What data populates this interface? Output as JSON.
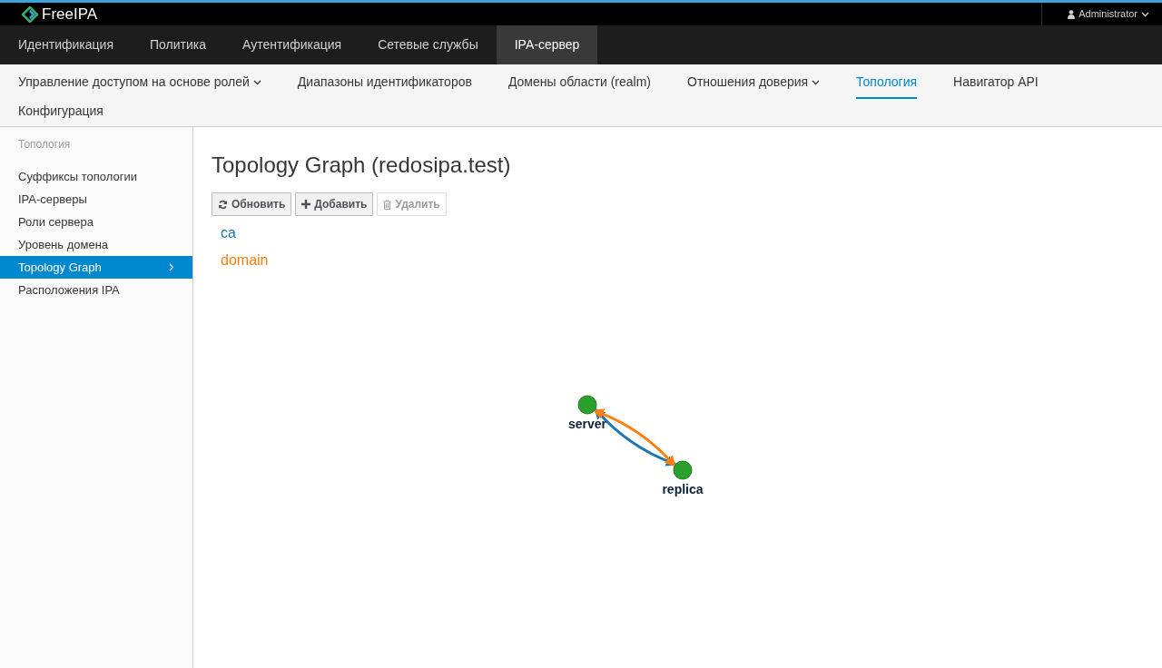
{
  "brand": "FreeIPA",
  "user": {
    "name": "Administrator"
  },
  "main_nav": [
    {
      "label": "Идентификация",
      "selected": false
    },
    {
      "label": "Политика",
      "selected": false
    },
    {
      "label": "Аутентификация",
      "selected": false
    },
    {
      "label": "Сетевые службы",
      "selected": false
    },
    {
      "label": "IPA-сервер",
      "selected": true
    }
  ],
  "sub_nav": [
    {
      "label": "Управление доступом на основе ролей",
      "dropdown": true,
      "selected": false
    },
    {
      "label": "Диапазоны идентификаторов",
      "dropdown": false,
      "selected": false
    },
    {
      "label": "Домены области (realm)",
      "dropdown": false,
      "selected": false
    },
    {
      "label": "Отношения доверия",
      "dropdown": true,
      "selected": false
    },
    {
      "label": "Топология",
      "dropdown": false,
      "selected": true
    },
    {
      "label": "Навигатор API",
      "dropdown": false,
      "selected": false
    },
    {
      "label": "Конфигурация",
      "dropdown": false,
      "selected": false
    }
  ],
  "sidebar": {
    "heading": "Топология",
    "items": [
      {
        "label": "Суффиксы топологии",
        "selected": false
      },
      {
        "label": "IPA-серверы",
        "selected": false
      },
      {
        "label": "Роли сервера",
        "selected": false
      },
      {
        "label": "Уровень домена",
        "selected": false
      },
      {
        "label": "Topology Graph",
        "selected": true
      },
      {
        "label": "Расположения IPA",
        "selected": false
      }
    ]
  },
  "page_title": "Topology Graph (redosipa.test)",
  "buttons": [
    {
      "kind": "refresh",
      "label": "Обновить",
      "disabled": false
    },
    {
      "kind": "add",
      "label": "Добавить",
      "disabled": false
    },
    {
      "kind": "delete",
      "label": "Удалить",
      "disabled": true
    }
  ],
  "suffixes": [
    {
      "label": "ca",
      "color": "#1f77b4"
    },
    {
      "label": "domain",
      "color": "#ff7f0e"
    }
  ],
  "graph": {
    "nodes": [
      {
        "label": "server"
      },
      {
        "label": "replica"
      }
    ],
    "edges": [
      {
        "color": "#1f77b4"
      },
      {
        "color": "#ff7f0e"
      }
    ]
  }
}
